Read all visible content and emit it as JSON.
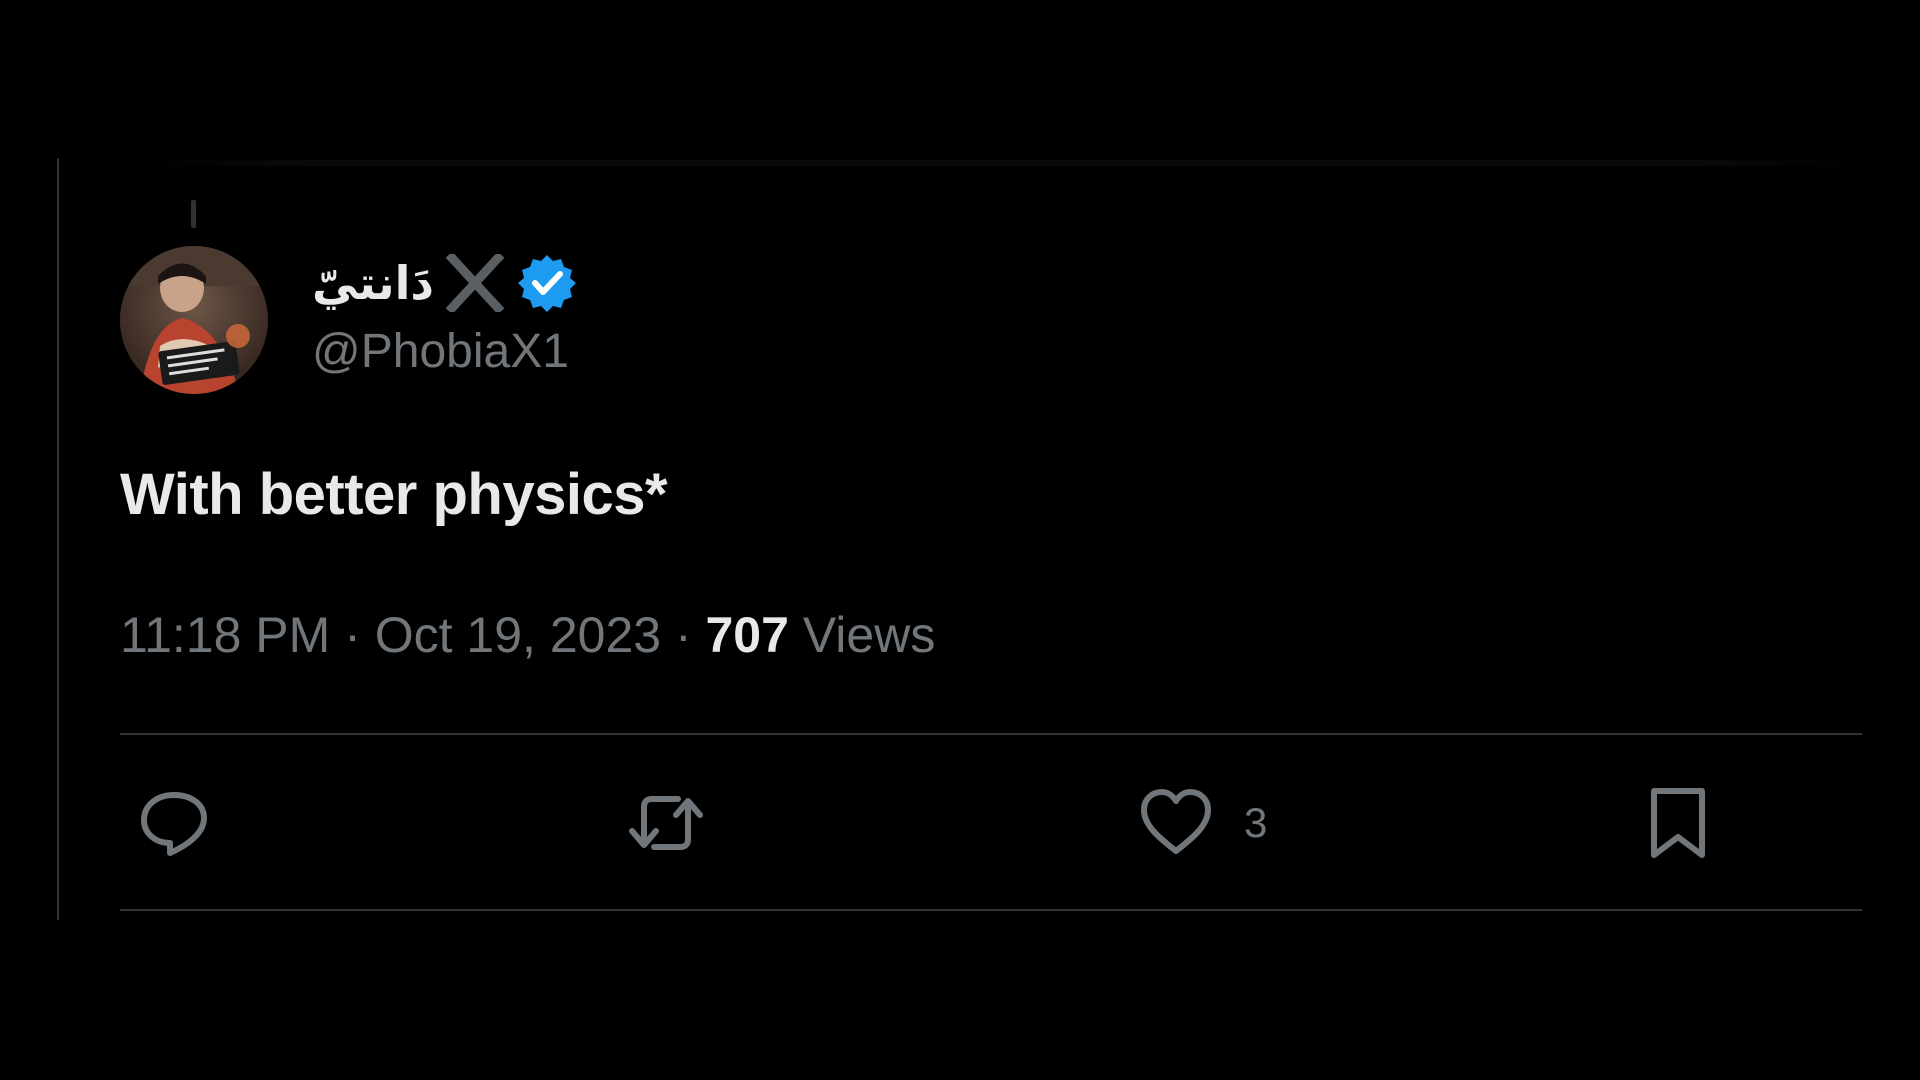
{
  "author": {
    "display_name": "دَانتيّ",
    "handle": "@PhobiaX1",
    "verified": true,
    "avatar_icon": "profile-photo",
    "badge_icon": "x-icon",
    "verified_icon": "verified-badge-icon"
  },
  "tweet": {
    "text": "With better physics*"
  },
  "meta": {
    "time": "11:18 PM",
    "separator": " · ",
    "date": "Oct 19, 2023",
    "views_count": "707",
    "views_label": "Views"
  },
  "actions": {
    "reply_icon": "reply-icon",
    "retweet_icon": "retweet-icon",
    "like_icon": "heart-icon",
    "like_count": "3",
    "bookmark_icon": "bookmark-icon"
  },
  "colors": {
    "background": "#000000",
    "primary_text": "#e7e9ea",
    "secondary_text": "#71767b",
    "divider": "#2f3336",
    "verified_blue": "#1d9bf0"
  }
}
